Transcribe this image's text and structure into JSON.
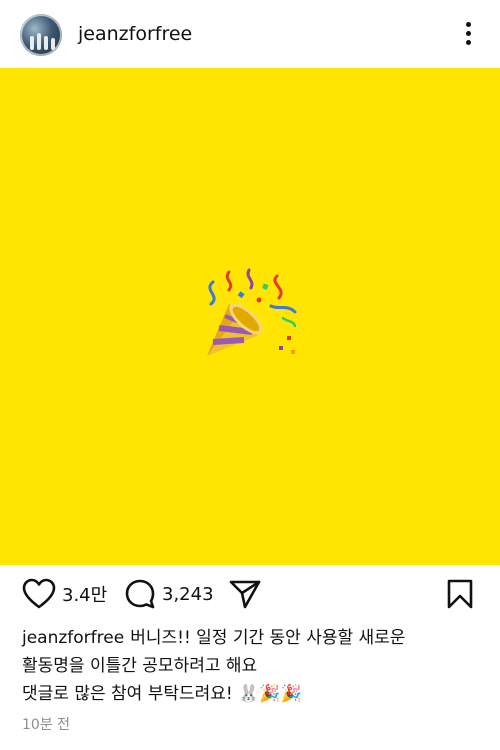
{
  "post": {
    "username": "jeanzforfree",
    "image_background": "#ffe500",
    "image_emoji": "party-popper",
    "likes": "3.4만",
    "comments": "3,243",
    "caption_line1": "버니즈!! 일정 기간 동안 사용할 새로운",
    "caption_line2": "활동명을 이틀간 공모하려고 해요",
    "caption_line3": "댓글로 많은 참여 부탁드려요! 🐰🎉🎉",
    "time_ago": "10분 전"
  },
  "icons": {
    "more": "more-options-icon",
    "like": "heart-icon",
    "comment": "comment-icon",
    "share": "send-icon",
    "save": "bookmark-icon"
  }
}
